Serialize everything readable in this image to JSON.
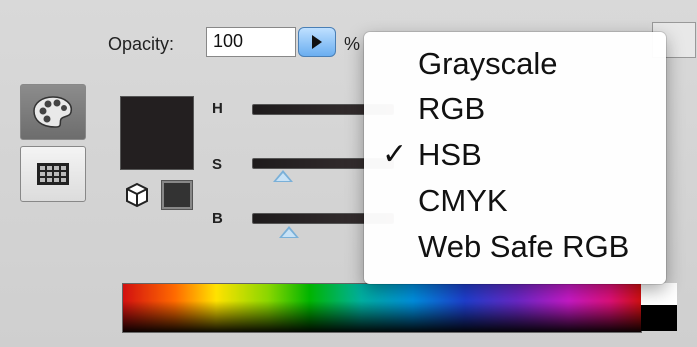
{
  "opacity": {
    "label": "Opacity:",
    "value": "100",
    "unit": "%"
  },
  "mode_buttons": [
    {
      "icon": "palette-icon",
      "selected": true
    },
    {
      "icon": "swatch-grid-icon",
      "selected": false
    }
  ],
  "color": {
    "foreground": "#231f20",
    "small_swatch": "#333333"
  },
  "sliders": [
    {
      "label": "H"
    },
    {
      "label": "S"
    },
    {
      "label": "B"
    }
  ],
  "menu": {
    "items": [
      {
        "label": "Grayscale",
        "checked": false
      },
      {
        "label": "RGB",
        "checked": false
      },
      {
        "label": "HSB",
        "checked": true
      },
      {
        "label": "CMYK",
        "checked": false
      },
      {
        "label": "Web Safe RGB",
        "checked": false
      }
    ],
    "check_glyph": "✓"
  }
}
